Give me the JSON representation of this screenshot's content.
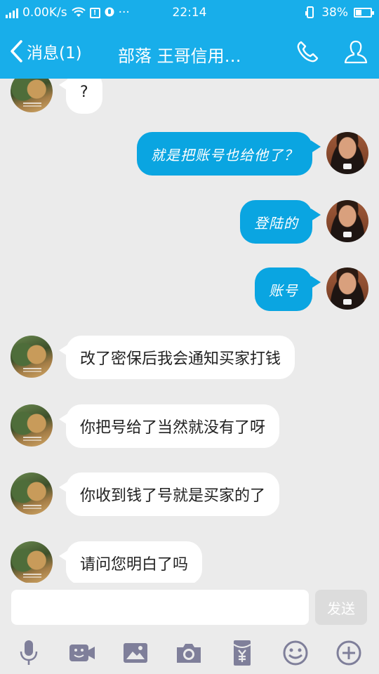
{
  "statusbar": {
    "network_speed": "0.00K/s",
    "alert_glyph": "!",
    "dots": "···",
    "time": "22:14",
    "battery": "38%",
    "battery_level": 0.38
  },
  "header": {
    "back_label": "消息(1)",
    "title": "部落 王哥信用…",
    "icons": [
      "phone-icon",
      "person-icon"
    ],
    "color": "#18aeea"
  },
  "messages": [
    {
      "side": "in",
      "text": "?"
    },
    {
      "side": "out",
      "text": "就是把账号也给他了？"
    },
    {
      "side": "out",
      "text": "登陆的"
    },
    {
      "side": "out",
      "text": "账号"
    },
    {
      "side": "in",
      "text": "改了密保后我会通知买家打钱"
    },
    {
      "side": "in",
      "text": "你把号给了当然就没有了呀"
    },
    {
      "side": "in",
      "text": "你收到钱了号就是买家的了"
    },
    {
      "side": "in",
      "text": "请问您明白了吗"
    }
  ],
  "input": {
    "value": "",
    "placeholder": "",
    "send_label": "发送"
  },
  "toolbar": {
    "icons": [
      "microphone-icon",
      "video-call-icon",
      "image-icon",
      "camera-icon",
      "red-packet-icon",
      "emoji-icon",
      "plus-icon"
    ]
  },
  "colors": {
    "accent": "#18aeea",
    "outgoing_bubble": "#0aa5e1",
    "incoming_bubble": "#ffffff",
    "background": "#ebebeb",
    "icon": "#7f7f9a"
  }
}
